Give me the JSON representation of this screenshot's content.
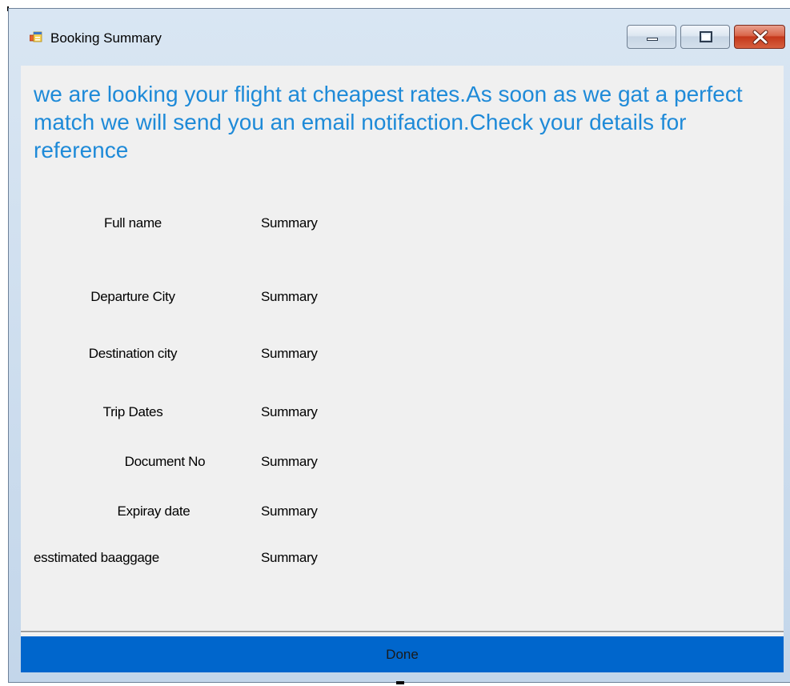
{
  "window": {
    "title": "Booking Summary",
    "icon": "app-form-icon",
    "controls": [
      "minimize-icon",
      "maximize-icon",
      "close-icon"
    ]
  },
  "message": "we are looking your flight at cheapest rates.As soon as we gat a perfect match we will send you an email notifaction.Check your details for reference",
  "rows": [
    {
      "label": "Full name",
      "value": "Summary"
    },
    {
      "label": "Departure City",
      "value": "Summary"
    },
    {
      "label": "Destination city",
      "value": "Summary"
    },
    {
      "label": "Trip Dates",
      "value": "Summary"
    },
    {
      "label": "Document No",
      "value": "Summary"
    },
    {
      "label": "Expiray date",
      "value": "Summary"
    },
    {
      "label": "esstimated baaggage",
      "value": "Summary"
    }
  ],
  "done_label": "Done",
  "colors": {
    "message": "#1e8ad8",
    "done_button": "#0066cc",
    "client_background": "#f0f0f0"
  }
}
